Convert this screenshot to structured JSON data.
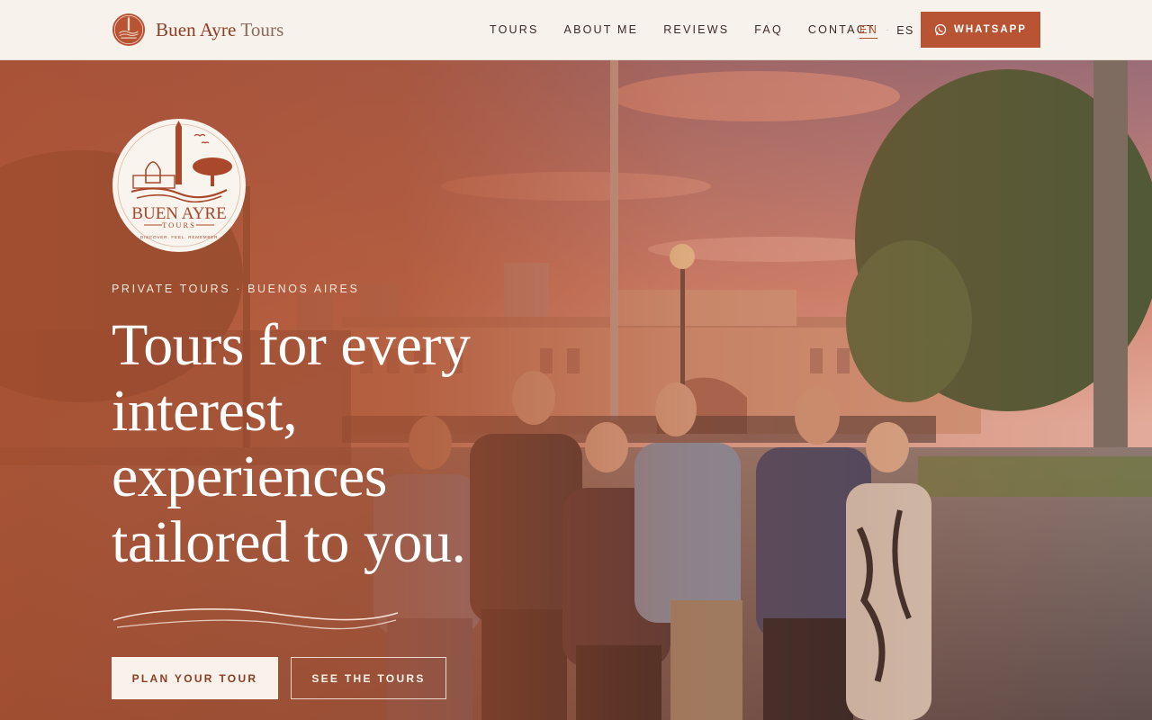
{
  "brand": {
    "name_main": "Buen Ayre",
    "name_light": "Tours"
  },
  "nav": {
    "items": [
      "TOURS",
      "ABOUT ME",
      "REVIEWS",
      "FAQ",
      "CONTACT"
    ]
  },
  "lang": {
    "active": "EN",
    "separator": "·",
    "other": "ES"
  },
  "header_cta": {
    "label": "WHATSAPP",
    "icon": "whatsapp-icon"
  },
  "hero": {
    "badge": {
      "title": "BUEN AYRE",
      "subtitle": "TOURS",
      "motto": "· DISCOVER. FEEL. REMEMBER ·"
    },
    "kicker": "PRIVATE TOURS · BUENOS AIRES",
    "headline": "Tours for every interest, experiences tailored to you.",
    "primary_button": "PLAN YOUR TOUR",
    "secondary_button": "SEE THE TOURS"
  },
  "colors": {
    "brand": "#b85434",
    "brand_dark": "#8f3d22",
    "header_bg": "#f7f2ec",
    "text_dark": "#3b2a24"
  }
}
